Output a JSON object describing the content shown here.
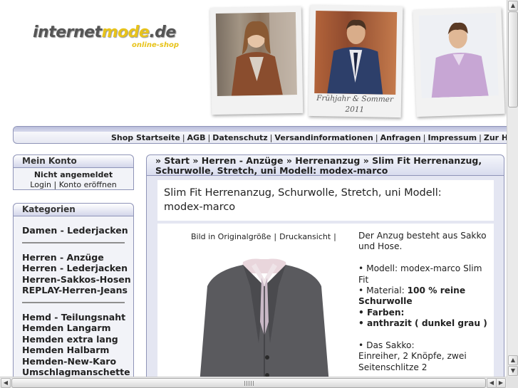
{
  "logo": {
    "text_main": "internet",
    "text_accent": "mode",
    "text_tld": ".de",
    "subtitle": "online-shop"
  },
  "banner": {
    "caption_line1": "Frühjahr & Sommer",
    "caption_line2": "2011"
  },
  "nav": {
    "links": [
      "Shop Startseite",
      "AGB",
      "Datenschutz",
      "Versandinformationen",
      "Anfragen",
      "Impressum",
      "Zur Homep"
    ],
    "separator": "|"
  },
  "konto": {
    "title": "Mein Konto",
    "status": "Nicht angemeldet",
    "login": "Login",
    "separator": "|",
    "register": "Konto eröffnen"
  },
  "kategorien": {
    "title": "Kategorien",
    "groups": [
      [
        "Damen - Lederjacken"
      ],
      [
        "Herren - Anzüge",
        "Herren - Lederjacken",
        "Herren-Sakkos-Hosen",
        "REPLAY-Herren-Jeans"
      ],
      [
        "Hemd - Teilungsnaht",
        "Hemden Langarm",
        "Hemden extra lang",
        "Hemden Halbarm",
        "Hemden-New-Karo",
        "Umschlagmanschette"
      ]
    ]
  },
  "breadcrumb": {
    "line1": "» Start » Herren - Anzüge » Herrenanzug » Slim Fit Herrenanzug,",
    "line2": "Schurwolle, Stretch, uni Modell: modex-marco"
  },
  "product": {
    "title_line1": "Slim Fit Herrenanzug, Schurwolle, Stretch, uni Modell:",
    "title_line2": "modex-marco",
    "link_original": "Bild in Originalgröße",
    "link_print": "Druckansicht",
    "link_sep": "|",
    "desc": {
      "intro": "Der Anzug besteht aus Sakko und Hose.",
      "modell": "• Modell: modex-marco Slim Fit",
      "material_label": "• Material: ",
      "material_value": "100 % reine Schurwolle",
      "farben": "• Farben:",
      "farbe1": "• anthrazit ( dunkel grau )",
      "sakko": "• Das Sakko:",
      "sakko_detail": "Einreiher, 2 Knöpfe, zwei Seitenschlitze 2"
    }
  },
  "colors": {
    "accent": "#e8c31a",
    "border": "#8f94b8",
    "panel": "#e4e6f2"
  }
}
